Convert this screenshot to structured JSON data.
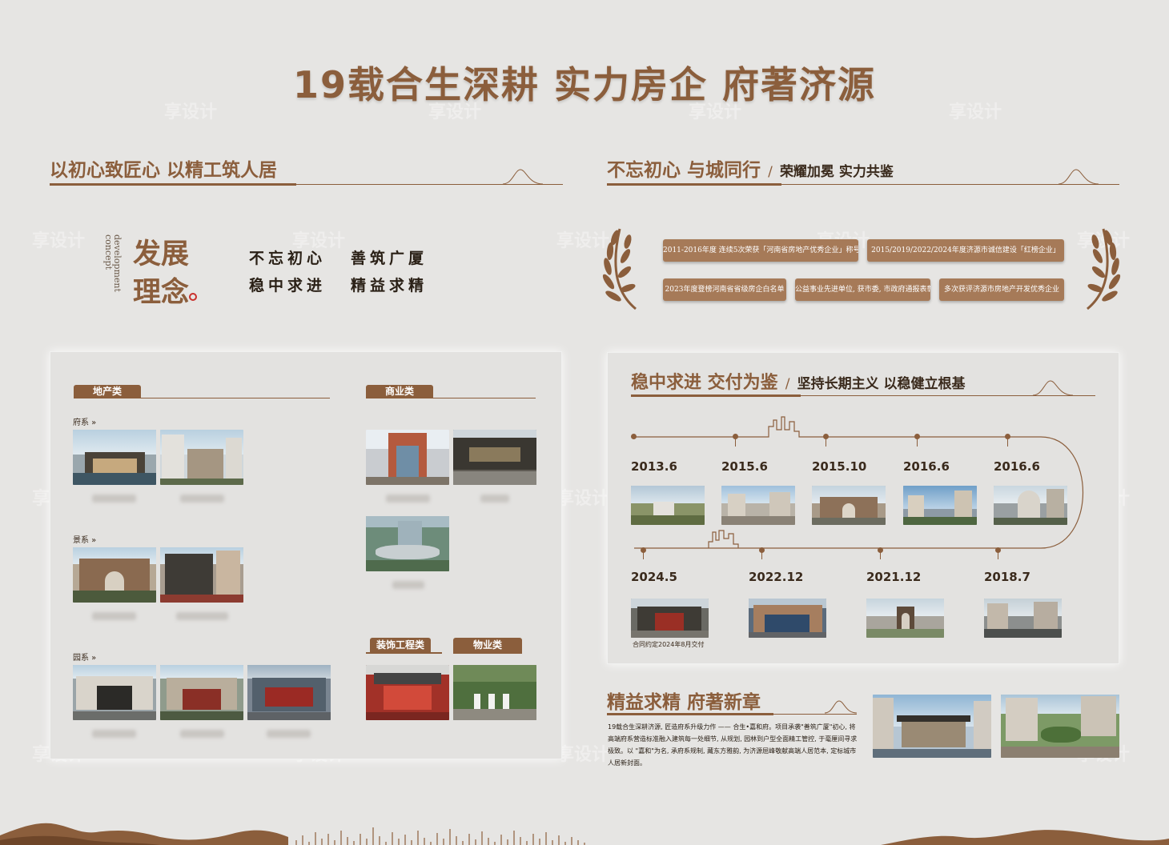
{
  "title": "19载合生深耕 实力房企 府著济源",
  "watermark": "享设计",
  "section_left": {
    "title": "以初心致匠心 以精工筑人居"
  },
  "section_right": {
    "title": "不忘初心 与城同行",
    "sep": "/",
    "subtitle": "荣耀加冕 实力共鉴"
  },
  "concept": {
    "en": "development concept",
    "title_line1": "发展",
    "title_line2": "理念",
    "slogans": [
      "不忘初心",
      "善筑广厦",
      "稳中求进",
      "精益求精"
    ]
  },
  "categories": {
    "real_estate": {
      "label": "地产类",
      "series": [
        {
          "name": "府系 »"
        },
        {
          "name": "景系 »"
        },
        {
          "name": "园系 »"
        }
      ]
    },
    "commercial": {
      "label": "商业类"
    },
    "decoration": {
      "label": "装饰工程类"
    },
    "property": {
      "label": "物业类"
    }
  },
  "honors": [
    "2011-2016年度 连续5次荣获「河南省房地产优秀企业」称号",
    "2015/2019/2022/2024年度济源市诚信建设「红榜企业」",
    "2023年度登榜河南省省级房企白名单",
    "公益事业先进单位, 获市委, 市政府通报表彰",
    "多次获评济源市房地产开发优秀企业"
  ],
  "delivery": {
    "title": "稳中求进 交付为鉴",
    "sep": "/",
    "subtitle": "坚持长期主义 以稳健立根基",
    "dates_top": [
      "2013.6",
      "2015.6",
      "2015.10",
      "2016.6",
      "2016.6"
    ],
    "dates_bottom": [
      "2024.5",
      "2022.12",
      "2021.12",
      "2018.7"
    ],
    "note": "合同约定2024年8月交付"
  },
  "final": {
    "title": "精益求精 府著新章",
    "paragraph": "19载合生深耕济源, 匠造府系升级力作 —— 合生•嘉和府。项目承袭\"善筑广厦\"初心, 将高端府系营造标准融入建筑每一处细节, 从规划, 园林到户型全面精工管控, 于毫厘间寻求极致。以 \"嘉和\"为名, 承府系规制, 藏东方雅韵, 为济源屈峰敬献高端人居范本, 定标城市人居新封面。"
  },
  "colors": {
    "accent": "#8b5e3c",
    "honor_bg": "#a67a58",
    "background": "#e6e5e3"
  }
}
